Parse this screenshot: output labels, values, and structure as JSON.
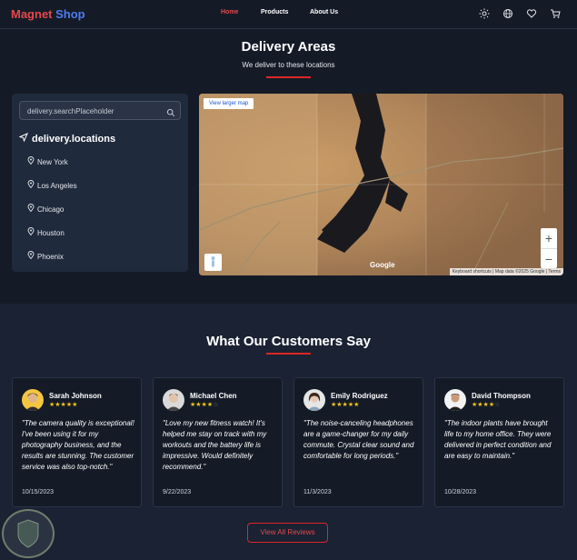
{
  "header": {
    "brand_part1": "Magnet",
    "brand_part2": "Shop",
    "nav": [
      "Home",
      "Products",
      "About Us"
    ],
    "active_nav": "Home",
    "icons": [
      "sun-icon",
      "globe-icon",
      "heart-icon",
      "cart-icon"
    ]
  },
  "delivery": {
    "title": "Delivery Areas",
    "subtitle": "We deliver to these locations",
    "search_placeholder": "delivery.searchPlaceholder",
    "locations_heading": "delivery.locations",
    "locations": [
      "New York",
      "Los Angeles",
      "Chicago",
      "Houston",
      "Phoenix"
    ],
    "map": {
      "larger_map_link": "View larger map",
      "attribution": "Keyboard shortcuts | Map data ©2025 Google | Terms",
      "google_label": "Google",
      "zoom_in": "+",
      "zoom_out": "−"
    }
  },
  "testimonials": {
    "title": "What Our Customers Say",
    "reviews": [
      {
        "name": "Sarah Johnson",
        "rating": 5,
        "text": "\"The camera quality is exceptional! I've been using it for my photography business, and the results are stunning. The customer service was also top-notch.\"",
        "date": "10/15/2023"
      },
      {
        "name": "Michael Chen",
        "rating": 4,
        "text": "\"Love my new fitness watch! It's helped me stay on track with my workouts and the battery life is impressive. Would definitely recommend.\"",
        "date": "9/22/2023"
      },
      {
        "name": "Emily Rodriguez",
        "rating": 5,
        "text": "\"The noise-canceling headphones are a game-changer for my daily commute. Crystal clear sound and comfortable for long periods.\"",
        "date": "11/3/2023"
      },
      {
        "name": "David Thompson",
        "rating": 4,
        "text": "\"The indoor plants have brought life to my home office. They were delivered in perfect condition and are easy to maintain.\"",
        "date": "10/28/2023"
      }
    ],
    "view_all_label": "View All Reviews"
  },
  "colors": {
    "accent": "#dc2626",
    "brand_blue": "#4f7bf0",
    "star": "#f5c518",
    "background": "#1a2233"
  }
}
